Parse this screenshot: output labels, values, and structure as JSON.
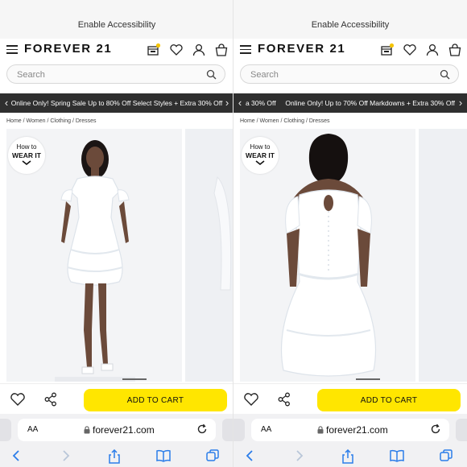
{
  "panels": [
    {
      "accessibility": "Enable Accessibility",
      "logo": "FOREVER 21",
      "search_placeholder": "Search",
      "promo": "Online Only! Spring Sale Up to 80% Off Select Styles + Extra 30% Off",
      "breadcrumb": "Home / Women / Clothing / Dresses",
      "how_to_line1": "How to",
      "how_to_line2": "WEAR IT",
      "add_to_cart": "ADD TO CART",
      "aa": "AA",
      "url": "forever21.com"
    },
    {
      "accessibility": "Enable Accessibility",
      "logo": "FOREVER 21",
      "search_placeholder": "Search",
      "promo": "a 30% Off     Online Only! Up to 70% Off Markdowns + Extra 30% Off",
      "breadcrumb": "Home / Women / Clothing / Dresses",
      "how_to_line1": "How to",
      "how_to_line2": "WEAR IT",
      "add_to_cart": "ADD TO CART",
      "aa": "AA",
      "url": "forever21.com"
    }
  ],
  "colors": {
    "cart_button": "#ffe600",
    "promo_bar": "#2f2f2f",
    "store_badge": "#f5c400",
    "safari_blue": "#2b7de9"
  },
  "icons": [
    "menu-icon",
    "store-icon",
    "heart-icon",
    "account-icon",
    "bag-icon",
    "search-icon",
    "share-icon",
    "lock-icon",
    "reload-icon",
    "back-icon",
    "forward-icon",
    "safari-share-icon",
    "bookmarks-icon",
    "tabs-icon"
  ]
}
